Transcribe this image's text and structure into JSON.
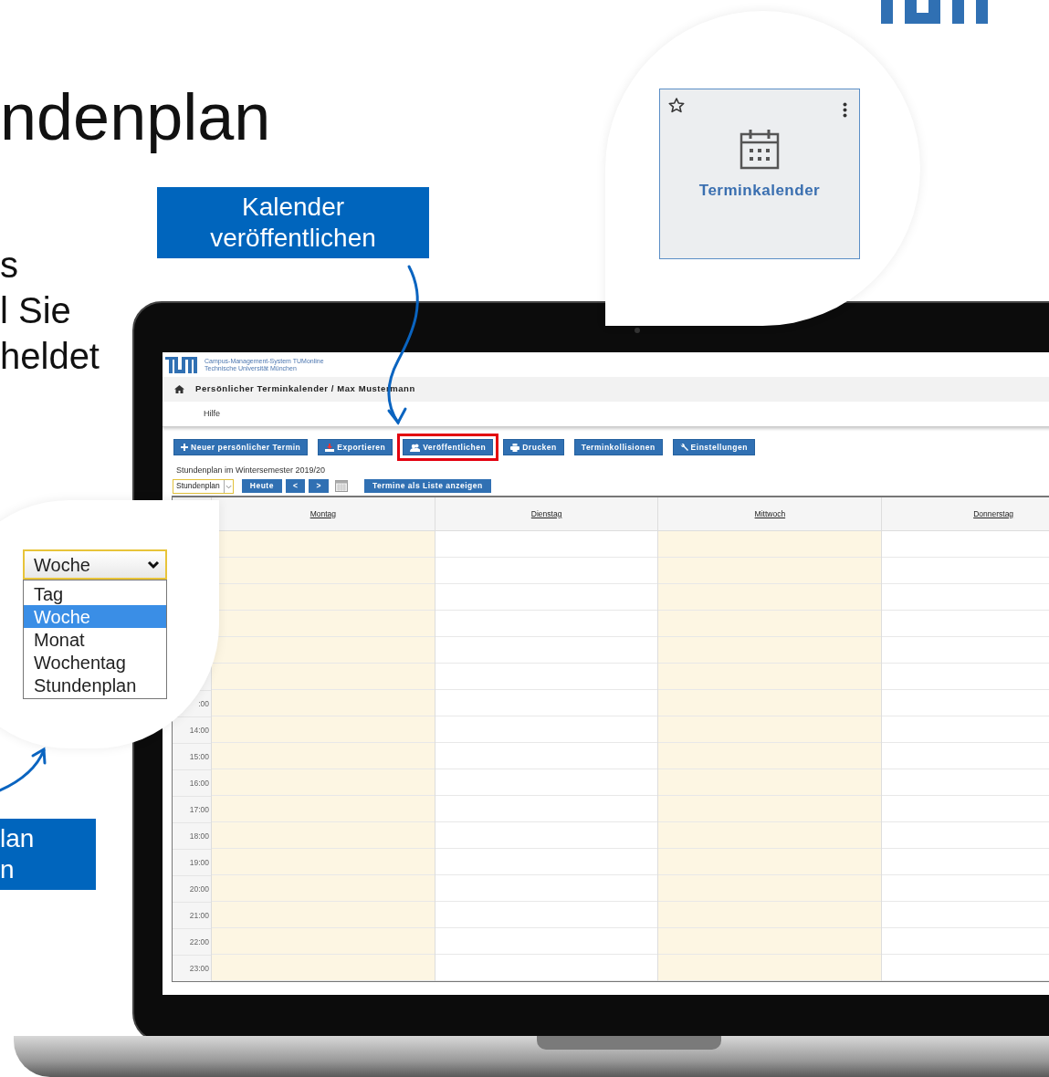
{
  "slide": {
    "title": "ndenplan",
    "text_lines": [
      "s",
      "l Sie",
      "heldet"
    ]
  },
  "callouts": [
    {
      "lines": [
        "Kalender",
        "veröffentlichen"
      ]
    },
    {
      "lines": [
        "lan",
        "n"
      ]
    }
  ],
  "tile": {
    "label": "Terminkalender"
  },
  "dropdown_zoom": {
    "value": "Woche",
    "options": [
      {
        "label": "Tag",
        "selected": false
      },
      {
        "label": "Woche",
        "selected": true
      },
      {
        "label": "Monat",
        "selected": false
      },
      {
        "label": "Wochentag",
        "selected": false
      },
      {
        "label": "Stundenplan",
        "selected": false
      }
    ]
  },
  "app": {
    "header_lines": [
      "Campus-Management-System TUMonline",
      "Technische Universität München"
    ],
    "breadcrumb": "Persönlicher Terminkalender / Max Mustermann",
    "menu": [
      "Hilfe"
    ],
    "toolbar": [
      {
        "label": "Neuer persönlicher Termin",
        "highlighted": false
      },
      {
        "label": "Exportieren",
        "highlighted": false
      },
      {
        "label": "Veröffentlichen",
        "highlighted": true
      },
      {
        "label": "Drucken",
        "highlighted": false
      },
      {
        "label": "Terminkollisionen",
        "highlighted": false
      },
      {
        "label": "Einstellungen",
        "highlighted": false
      }
    ],
    "caption": "Stundenplan im Wintersemester 2019/20",
    "view_select": "Stundenplan",
    "nav_buttons": [
      "Heute",
      "<",
      ">"
    ],
    "list_button": "Termine als Liste anzeigen",
    "days": [
      {
        "label": "Montag",
        "shaded": true
      },
      {
        "label": "Dienstag",
        "shaded": false
      },
      {
        "label": "Mittwoch",
        "shaded": true
      },
      {
        "label": "Donnerstag",
        "shaded": false
      }
    ],
    "times": [
      ":00",
      "14:00",
      "15:00",
      "16:00",
      "17:00",
      "18:00",
      "19:00",
      "20:00",
      "21:00",
      "22:00",
      "23:00"
    ]
  }
}
